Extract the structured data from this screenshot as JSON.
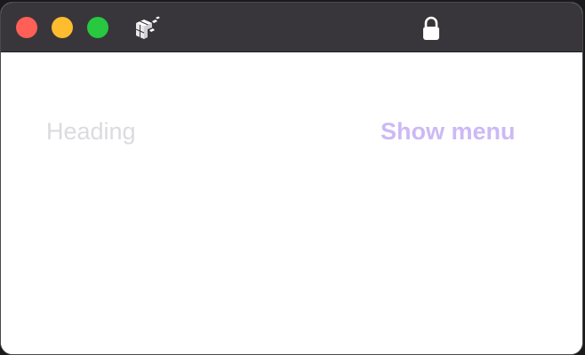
{
  "window": {
    "controls": {
      "close_color": "#fe5f57",
      "minimize_color": "#febc2e",
      "zoom_color": "#28c840"
    },
    "titlebar": {
      "app_icon": "cube-logo-icon",
      "security_icon": "lock-icon"
    }
  },
  "page": {
    "heading": "Heading",
    "menu_toggle_label": "Show menu",
    "colors": {
      "heading_text": "#dcdadf",
      "accent": "#cdb9f5"
    }
  }
}
